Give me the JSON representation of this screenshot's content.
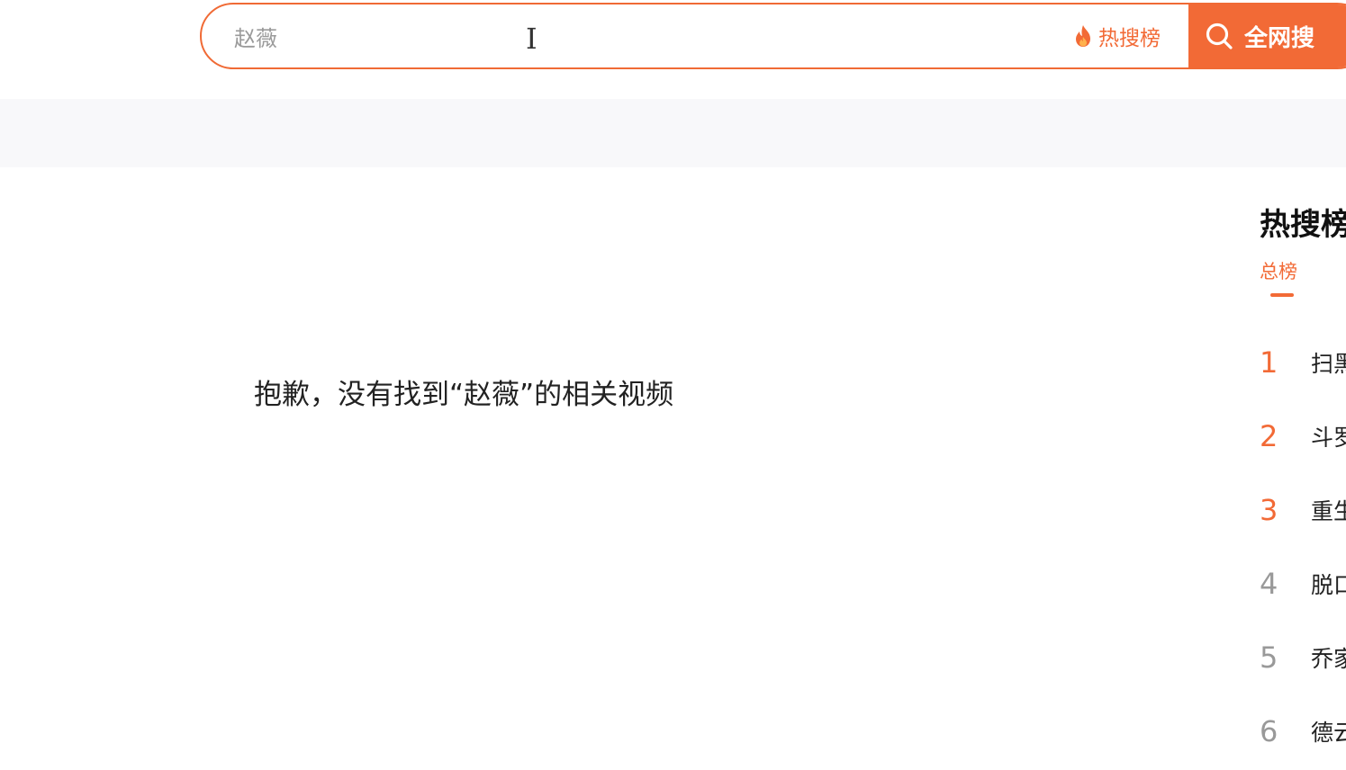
{
  "search": {
    "value": "赵薇",
    "hot_label": "热搜榜",
    "button_label": "全网搜"
  },
  "result": {
    "empty_message": "抱歉，没有找到“赵薇”的相关视频"
  },
  "hot_panel": {
    "title": "热搜榜",
    "tab": "总榜",
    "items": [
      {
        "rank": "1",
        "text": "扫黑"
      },
      {
        "rank": "2",
        "text": "斗罗"
      },
      {
        "rank": "3",
        "text": "重生"
      },
      {
        "rank": "4",
        "text": "脱口"
      },
      {
        "rank": "5",
        "text": "乔家"
      },
      {
        "rank": "6",
        "text": "德云"
      }
    ]
  },
  "colors": {
    "accent": "#f26a36",
    "rank_gray": "#999999"
  }
}
